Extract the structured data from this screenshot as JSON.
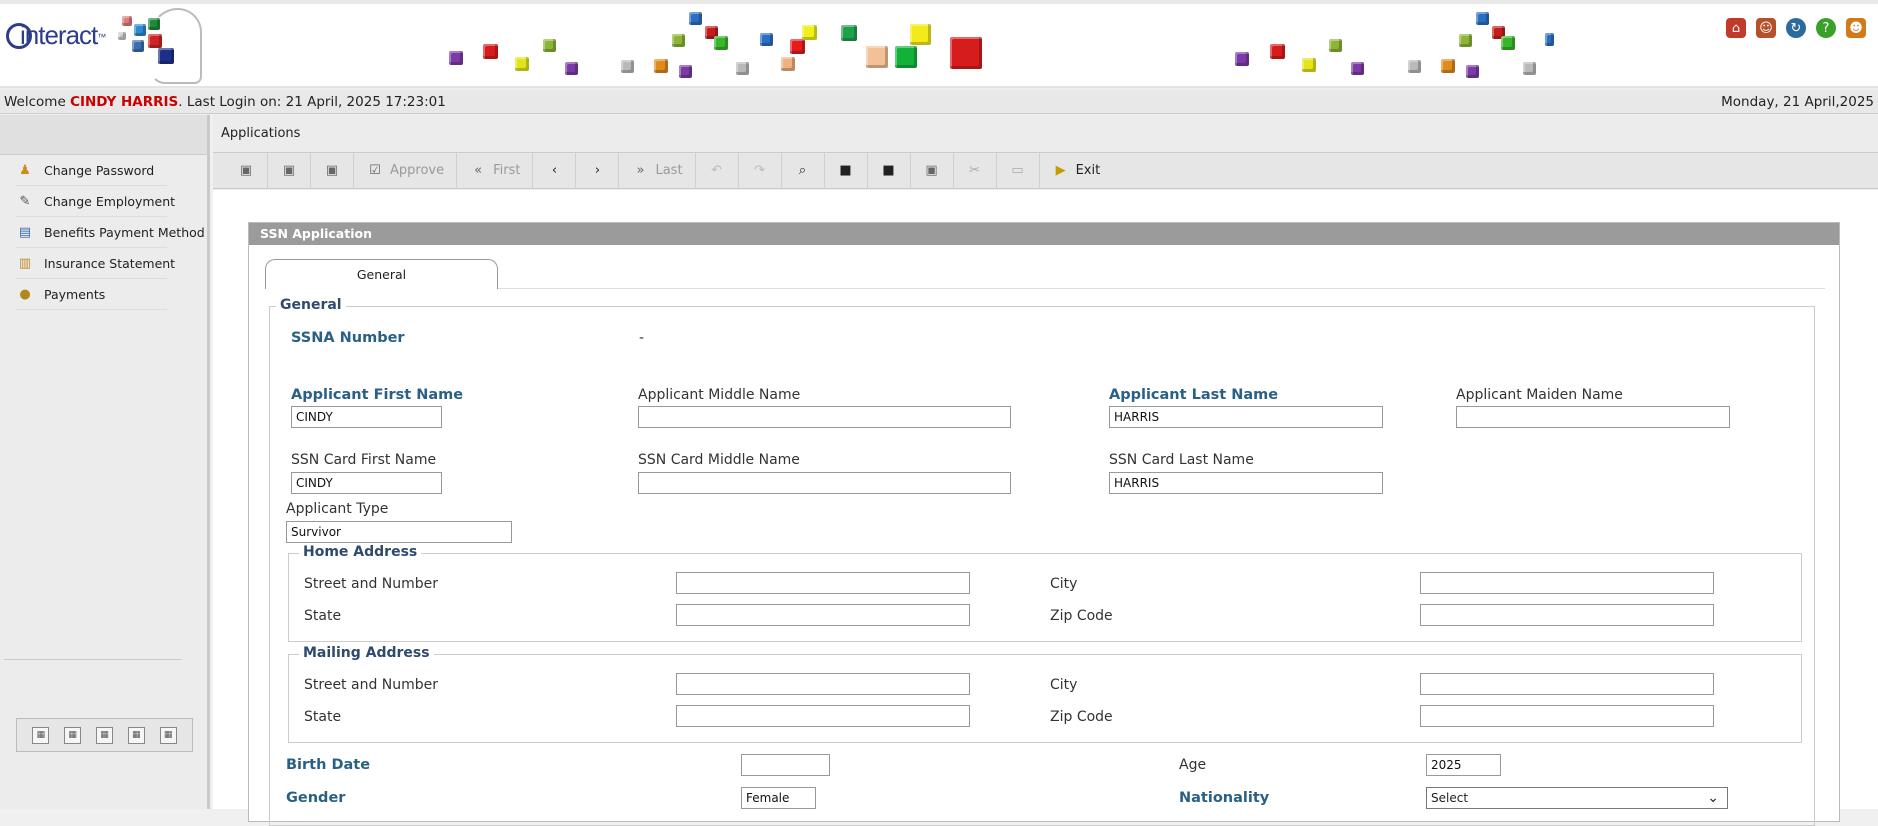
{
  "branding": {
    "logo_text": "interact",
    "logo_mark": "™",
    "top_icons": [
      "home-icon",
      "user-icon",
      "refresh-icon",
      "help-icon",
      "logout-icon"
    ]
  },
  "welcome": {
    "prefix": "Welcome",
    "user": "CINDY HARRIS",
    "last_login": ". Last Login on: 21 April, 2025 17:23:01",
    "date": "Monday, 21 April,2025"
  },
  "sidebar": {
    "items": [
      {
        "label": "Change Password",
        "icon": "key-user-icon"
      },
      {
        "label": "Change Employment",
        "icon": "pencil-icon"
      },
      {
        "label": "Benefits Payment Method",
        "icon": "document-icon"
      },
      {
        "label": "Insurance Statement",
        "icon": "statement-icon"
      },
      {
        "label": "Payments",
        "icon": "money-bag-icon"
      }
    ]
  },
  "main": {
    "header": "Applications"
  },
  "toolbar": {
    "approve": "Approve",
    "first": "First",
    "last": "Last",
    "exit": "Exit"
  },
  "form": {
    "panel_title": "SSN Application",
    "tab_general": "General",
    "legend_general": "General",
    "ssna_label": "SSNA Number",
    "ssna_value": "-",
    "applicant_first_label": "Applicant First Name",
    "applicant_first_value": "CINDY",
    "applicant_middle_label": "Applicant Middle Name",
    "applicant_middle_value": "",
    "applicant_last_label": "Applicant Last Name",
    "applicant_last_value": "HARRIS",
    "applicant_maiden_label": "Applicant Maiden Name",
    "applicant_maiden_value": "",
    "card_first_label": "SSN Card First Name",
    "card_first_value": "CINDY",
    "card_middle_label": "SSN Card Middle Name",
    "card_middle_value": "",
    "card_last_label": "SSN Card Last Name",
    "card_last_value": "HARRIS",
    "applicant_type_label": "Applicant Type",
    "applicant_type_value": "Survivor",
    "home_address": {
      "legend": "Home Address",
      "street_label": "Street and Number",
      "city_label": "City",
      "state_label": "State",
      "zip_label": "Zip Code"
    },
    "mailing_address": {
      "legend": "Mailing Address",
      "street_label": "Street and Number",
      "city_label": "City",
      "state_label": "State",
      "zip_label": "Zip Code"
    },
    "birth_date_label": "Birth Date",
    "birth_date_value": "",
    "age_label": "Age",
    "age_value": "2025",
    "gender_label": "Gender",
    "gender_value": "Female",
    "nationality_label": "Nationality",
    "nationality_value": "Select"
  }
}
